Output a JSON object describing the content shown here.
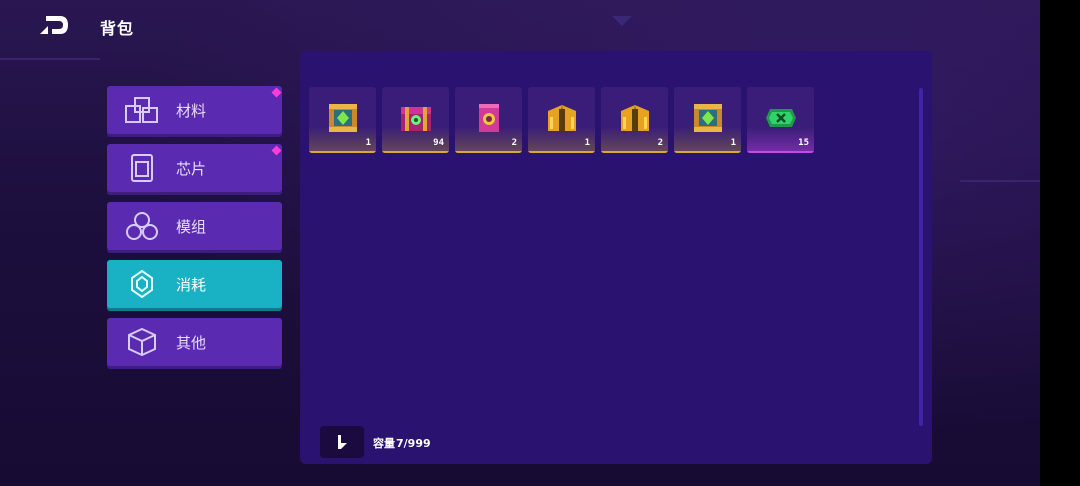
{
  "header": {
    "title": "背包",
    "back_icon": "back-arrow-icon"
  },
  "categories": [
    {
      "label": "材料",
      "icon": "materials-icon",
      "badge": true,
      "active": false
    },
    {
      "label": "芯片",
      "icon": "chip-icon",
      "badge": true,
      "active": false
    },
    {
      "label": "模组",
      "icon": "module-icon",
      "badge": false,
      "active": false
    },
    {
      "label": "消耗",
      "icon": "consumable-icon",
      "badge": false,
      "active": true
    },
    {
      "label": "其他",
      "icon": "cube-icon",
      "badge": false,
      "active": false
    }
  ],
  "items": [
    {
      "icon": "green-gem-crate-icon",
      "count": "1",
      "rarity": "gold"
    },
    {
      "icon": "purple-chest-icon",
      "count": "94",
      "rarity": "gold"
    },
    {
      "icon": "purple-potion-jar-icon",
      "count": "2",
      "rarity": "gold"
    },
    {
      "icon": "golden-wings-icon",
      "count": "1",
      "rarity": "gold"
    },
    {
      "icon": "golden-wings-icon",
      "count": "2",
      "rarity": "gold"
    },
    {
      "icon": "green-gem-crate-icon",
      "count": "1",
      "rarity": "gold"
    },
    {
      "icon": "green-ticket-icon",
      "count": "15",
      "rarity": "epic"
    }
  ],
  "footer": {
    "capacity_label": "容量",
    "capacity_value": "7/999",
    "sort_icon": "sort-icon"
  },
  "colors": {
    "active_tab": "#19b1c4",
    "tab": "#5a2bb0",
    "panel": "#2a1270",
    "badge": "#ff3bd9"
  }
}
